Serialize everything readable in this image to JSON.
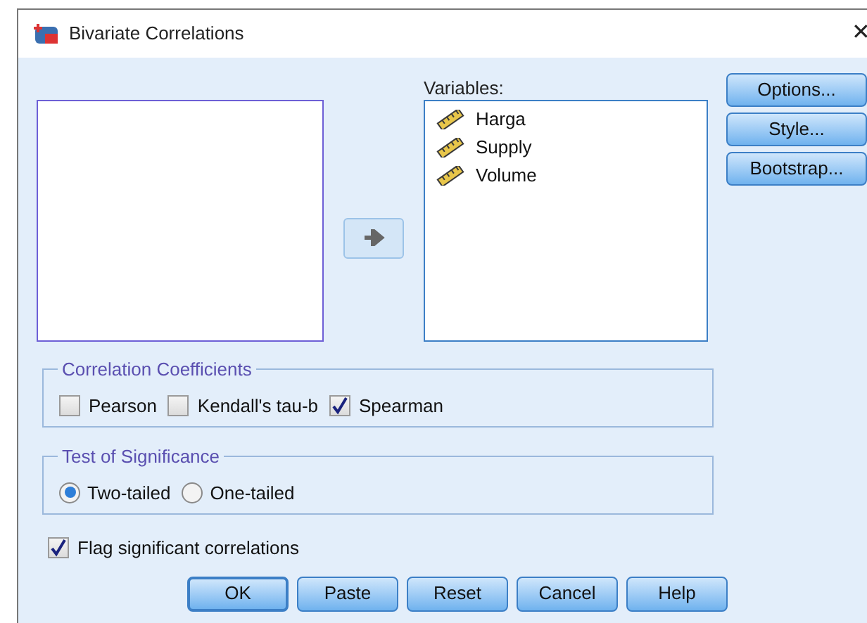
{
  "window": {
    "title": "Bivariate Correlations",
    "close": "✕"
  },
  "variables": {
    "label": "Variables:",
    "items": [
      {
        "name": "Harga"
      },
      {
        "name": "Supply"
      },
      {
        "name": "Volume"
      }
    ]
  },
  "side_buttons": [
    "Options...",
    "Style...",
    "Bootstrap..."
  ],
  "correlation_coefficients": {
    "title": "Correlation Coefficients",
    "options": [
      {
        "label": "Pearson",
        "checked": false
      },
      {
        "label": "Kendall's tau-b",
        "checked": false
      },
      {
        "label": "Spearman",
        "checked": true
      }
    ]
  },
  "test_of_significance": {
    "title": "Test of Significance",
    "options": [
      {
        "label": "Two-tailed",
        "selected": true
      },
      {
        "label": "One-tailed",
        "selected": false
      }
    ]
  },
  "flag": {
    "label": "Flag significant correlations",
    "checked": true
  },
  "buttons": [
    {
      "label": "OK",
      "default": true
    },
    {
      "label": "Paste",
      "default": false
    },
    {
      "label": "Reset",
      "default": false
    },
    {
      "label": "Cancel",
      "default": false
    },
    {
      "label": "Help",
      "default": false
    }
  ]
}
